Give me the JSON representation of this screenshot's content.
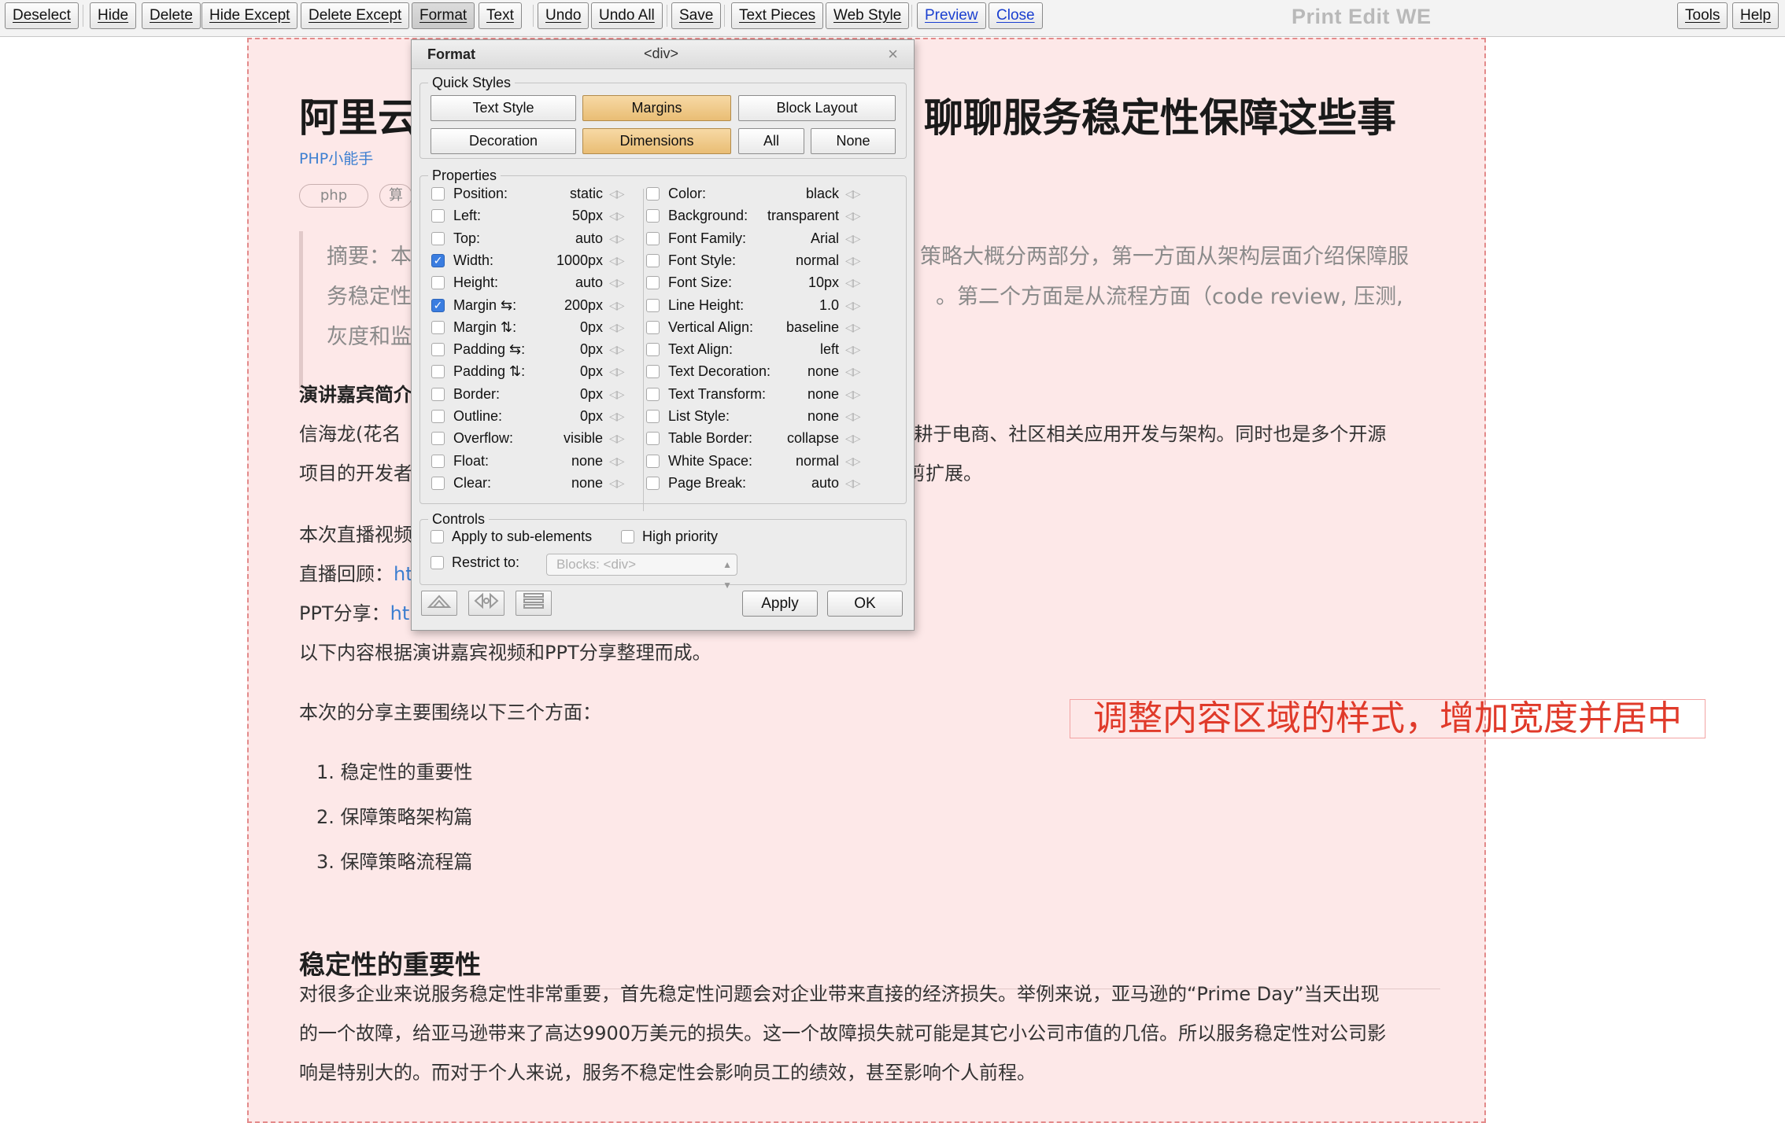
{
  "toolbar": {
    "buttons": [
      "Deselect",
      "Hide",
      "Delete",
      "Hide Except",
      "Delete Except",
      "Format",
      "Text",
      "Undo",
      "Undo All",
      "Save",
      "Text Pieces",
      "Web Style",
      "Preview",
      "Close"
    ],
    "app_title": "Print Edit WE",
    "tools_label": "Tools",
    "help_label": "Help"
  },
  "article": {
    "title_left": "阿里云",
    "title_right": "聊聊服务稳定性保障这些事",
    "author": "PHP小能手",
    "tags": [
      "php",
      "算"
    ],
    "summary_lines": [
      {
        "left": "摘要：本",
        "right": "策略大概分两部分，第一方面从架构层面介绍保障服"
      },
      {
        "left": "务稳定性",
        "right": "。第二个方面是从流程方面（code review, 压测,"
      },
      {
        "left": "灰度和监",
        "right": ""
      }
    ],
    "speaker_heading": "演讲嘉宾简介",
    "speaker_line1_left": "信海龙(花名",
    "speaker_line1_right": "深耕于电商、社区相关应用开发与架构。同时也是多个开源",
    "speaker_line2_left": "项目的开发者",
    "speaker_line2_right": "剪扩展。",
    "video_label": "本次直播视频",
    "replay_label": "直播回顾：",
    "replay_link": "ht",
    "ppt_label": "PPT分享：",
    "ppt_link": "ht",
    "source_note": "以下内容根据演讲嘉宾视频和PPT分享整理而成。",
    "intro": "本次的分享主要围绕以下三个方面：",
    "list": [
      "1. 稳定性的重要性",
      "2. 保障策略架构篇",
      "3. 保障策略流程篇"
    ],
    "section_heading": "稳定性的重要性",
    "para_lines": [
      "对很多企业来说服务稳定性非常重要，首先稳定性问题会对企业带来直接的经济损失。举例来说，亚马逊的“Prime Day”当天出现",
      "的一个故障，给亚马逊带来了高达9900万美元的损失。这一个故障损失就可能是其它小公司市值的几倍。所以服务稳定性对公司影",
      "响是特别大的。而对于个人来说，服务不稳定性会影响员工的绩效，甚至影响个人前程。"
    ]
  },
  "annotation": "调整内容区域的样式，增加宽度并居中",
  "format_dialog": {
    "title": "Format",
    "element": "<div>",
    "close_glyph": "×",
    "quick_styles_legend": "Quick Styles",
    "quick_styles": [
      {
        "label": "Text Style",
        "active": false
      },
      {
        "label": "Margins",
        "active": true
      },
      {
        "label": "Block Layout",
        "active": false
      },
      {
        "label": "Decoration",
        "active": false
      },
      {
        "label": "Dimensions",
        "active": true
      },
      {
        "label": "All",
        "active": false
      },
      {
        "label": "None",
        "active": false
      }
    ],
    "properties_legend": "Properties",
    "left_props": [
      {
        "label": "Position:",
        "value": "static",
        "checked": false
      },
      {
        "label": "Left:",
        "value": "50px",
        "checked": false
      },
      {
        "label": "Top:",
        "value": "auto",
        "checked": false
      },
      {
        "label": "Width:",
        "value": "1000px",
        "checked": true
      },
      {
        "label": "Height:",
        "value": "auto",
        "checked": false
      },
      {
        "label": "Margin ⇆:",
        "value": "200px",
        "checked": true
      },
      {
        "label": "Margin ⇅:",
        "value": "0px",
        "checked": false
      },
      {
        "label": "Padding ⇆:",
        "value": "0px",
        "checked": false
      },
      {
        "label": "Padding ⇅:",
        "value": "0px",
        "checked": false
      },
      {
        "label": "Border:",
        "value": "0px",
        "checked": false
      },
      {
        "label": "Outline:",
        "value": "0px",
        "checked": false
      },
      {
        "label": "Overflow:",
        "value": "visible",
        "checked": false
      },
      {
        "label": "Float:",
        "value": "none",
        "checked": false
      },
      {
        "label": "Clear:",
        "value": "none",
        "checked": false
      }
    ],
    "right_props": [
      {
        "label": "Color:",
        "value": "black",
        "checked": false
      },
      {
        "label": "Background:",
        "value": "transparent",
        "checked": false
      },
      {
        "label": "Font Family:",
        "value": "Arial",
        "checked": false
      },
      {
        "label": "Font Style:",
        "value": "normal",
        "checked": false
      },
      {
        "label": "Font Size:",
        "value": "10px",
        "checked": false
      },
      {
        "label": "Line Height:",
        "value": "1.0",
        "checked": false
      },
      {
        "label": "Vertical Align:",
        "value": "baseline",
        "checked": false
      },
      {
        "label": "Text Align:",
        "value": "left",
        "checked": false
      },
      {
        "label": "Text Decoration:",
        "value": "none",
        "checked": false
      },
      {
        "label": "Text Transform:",
        "value": "none",
        "checked": false
      },
      {
        "label": "List Style:",
        "value": "none",
        "checked": false
      },
      {
        "label": "Table Border:",
        "value": "collapse",
        "checked": false
      },
      {
        "label": "White Space:",
        "value": "normal",
        "checked": false
      },
      {
        "label": "Page Break:",
        "value": "auto",
        "checked": false
      }
    ],
    "controls_legend": "Controls",
    "apply_sub_label": "Apply to sub-elements",
    "high_priority_label": "High priority",
    "restrict_label": "Restrict to:",
    "restrict_value": "Blocks: <div>",
    "apply_label": "Apply",
    "ok_label": "OK"
  },
  "colors": {
    "page_background": "#fde8e8",
    "active_button": "#e9bd74",
    "annotation": "#e03a2a",
    "link": "#3d7fd1",
    "checkbox_checked": "#3a7de0"
  }
}
